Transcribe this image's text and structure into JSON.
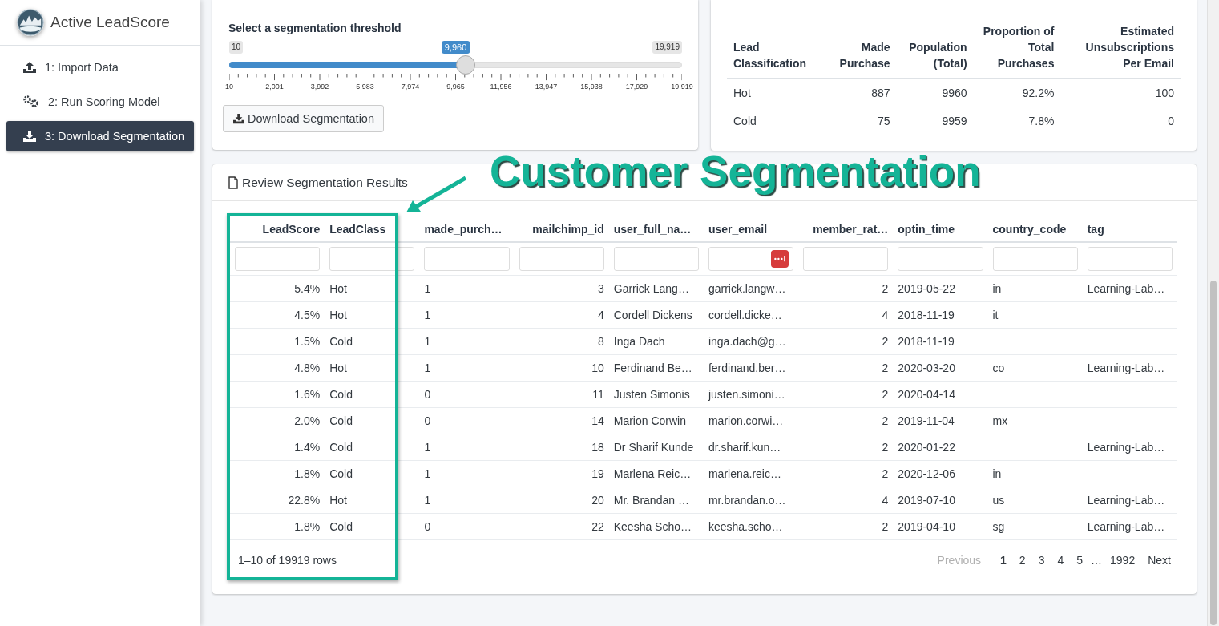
{
  "app": {
    "title": "Active LeadScore"
  },
  "sidebar": {
    "items": [
      {
        "label": "1: Import Data",
        "selected": false
      },
      {
        "label": "2: Run Scoring Model",
        "selected": false
      },
      {
        "label": "3: Download Segmentation",
        "selected": true
      }
    ]
  },
  "threshold_card": {
    "label": "Select a segmentation threshold",
    "slider": {
      "min_label": "10",
      "max_label": "19,919",
      "value_label": "9,960",
      "level": 0.5,
      "ticks": [
        "10",
        "2,001",
        "3,992",
        "5,983",
        "7,974",
        "9,965",
        "11,956",
        "13,947",
        "15,938",
        "17,929",
        "19,919"
      ]
    },
    "button": "Download Segmentation"
  },
  "summary_table": {
    "columns": [
      {
        "label": "Lead Classification",
        "kind": "text"
      },
      {
        "label": "Made Purchase",
        "kind": "number"
      },
      {
        "label": "Population (Total)",
        "kind": "number"
      },
      {
        "label": "Proportion of Total Purchases",
        "kind": "number"
      },
      {
        "label": "Estimated Unsubscriptions Per Email",
        "kind": "number"
      }
    ],
    "rows": [
      [
        "Hot",
        "887",
        "9960",
        "92.2%",
        "100"
      ],
      [
        "Cold",
        "75",
        "9959",
        "7.8%",
        "0"
      ]
    ]
  },
  "results_card": {
    "title": "Review Segmentation Results",
    "collapse": "—",
    "columns": [
      {
        "label": "LeadScore",
        "kind": "number"
      },
      {
        "label": "LeadClass",
        "kind": "text"
      },
      {
        "label": "made_purch…",
        "kind": "text"
      },
      {
        "label": "mailchimp_id",
        "kind": "number"
      },
      {
        "label": "user_full_na…",
        "kind": "text"
      },
      {
        "label": "user_email",
        "kind": "text"
      },
      {
        "label": "member_rat…",
        "kind": "number"
      },
      {
        "label": "optin_time",
        "kind": "text"
      },
      {
        "label": "country_code",
        "kind": "text"
      },
      {
        "label": "tag",
        "kind": "text"
      }
    ],
    "rows": [
      [
        "5.4%",
        "Hot",
        "1",
        "3",
        "Garrick Lang…",
        "garrick.langw…",
        "2",
        "2019-05-22",
        "in",
        "Learning-Lab…"
      ],
      [
        "4.5%",
        "Hot",
        "1",
        "4",
        "Cordell Dickens",
        "cordell.dicke…",
        "4",
        "2018-11-19",
        "it",
        ""
      ],
      [
        "1.5%",
        "Cold",
        "1",
        "8",
        "Inga Dach",
        "inga.dach@g…",
        "2",
        "2018-11-19",
        "",
        ""
      ],
      [
        "4.8%",
        "Hot",
        "1",
        "10",
        "Ferdinand Be…",
        "ferdinand.ber…",
        "2",
        "2020-03-20",
        "co",
        "Learning-Lab…"
      ],
      [
        "1.6%",
        "Cold",
        "0",
        "11",
        "Justen Simonis",
        "justen.simoni…",
        "2",
        "2020-04-14",
        "",
        ""
      ],
      [
        "2.0%",
        "Cold",
        "0",
        "14",
        "Marion Corwin",
        "marion.corwi…",
        "2",
        "2019-11-04",
        "mx",
        ""
      ],
      [
        "1.4%",
        "Cold",
        "1",
        "18",
        "Dr Sharif Kunde",
        "dr.sharif.kun…",
        "2",
        "2020-01-22",
        "",
        "Learning-Lab…"
      ],
      [
        "1.8%",
        "Cold",
        "1",
        "19",
        "Marlena Reic…",
        "marlena.reic…",
        "2",
        "2020-12-06",
        "in",
        ""
      ],
      [
        "22.8%",
        "Hot",
        "1",
        "20",
        "Mr. Brandan …",
        "mr.brandan.o…",
        "4",
        "2019-07-10",
        "us",
        "Learning-Lab…"
      ],
      [
        "1.8%",
        "Cold",
        "0",
        "22",
        "Keesha Scho…",
        "keesha.scho…",
        "2",
        "2019-04-10",
        "sg",
        "Learning-Lab…"
      ]
    ],
    "info": "1–10 of 19919 rows",
    "pagination": [
      {
        "label": "Previous",
        "kind": "nav",
        "disabled": true,
        "selected": false
      },
      {
        "label": "1",
        "kind": "page",
        "disabled": false,
        "selected": true
      },
      {
        "label": "2",
        "kind": "page",
        "disabled": false,
        "selected": false
      },
      {
        "label": "3",
        "kind": "page",
        "disabled": false,
        "selected": false
      },
      {
        "label": "4",
        "kind": "page",
        "disabled": false,
        "selected": false
      },
      {
        "label": "5",
        "kind": "page",
        "disabled": false,
        "selected": false
      },
      {
        "label": "…",
        "kind": "gap"
      },
      {
        "label": "1992",
        "kind": "page",
        "disabled": false,
        "selected": false
      },
      {
        "label": "Next",
        "kind": "nav",
        "disabled": false,
        "selected": false
      }
    ]
  },
  "annotation": {
    "text": "Customer Segmentation"
  }
}
